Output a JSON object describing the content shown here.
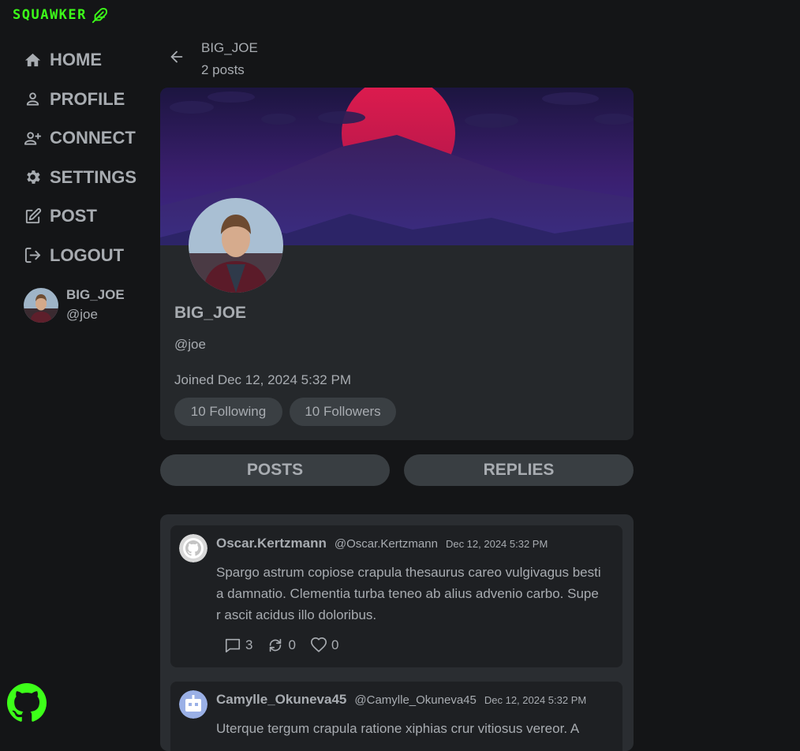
{
  "app": {
    "brand": "SQUAWKER",
    "accent_color": "#3dff19",
    "brand_icon": "feather-icon"
  },
  "sidebar": {
    "items": [
      {
        "label": "HOME",
        "icon": "home-icon"
      },
      {
        "label": "PROFILE",
        "icon": "person-icon"
      },
      {
        "label": "CONNECT",
        "icon": "person-add-icon"
      },
      {
        "label": "SETTINGS",
        "icon": "gear-icon"
      },
      {
        "label": "POST",
        "icon": "edit-icon"
      },
      {
        "label": "LOGOUT",
        "icon": "logout-icon"
      }
    ],
    "user": {
      "name": "BIG_JOE",
      "handle": "@joe"
    },
    "footer_icon": "github-icon"
  },
  "header": {
    "title": "BIG_JOE",
    "post_count": "2 posts"
  },
  "profile": {
    "name": "BIG_JOE",
    "handle": "@joe",
    "joined": "Joined Dec 12, 2024 5:32 PM",
    "following": "10 Following",
    "followers": "10 Followers"
  },
  "tabs": [
    {
      "label": "POSTS"
    },
    {
      "label": "REPLIES"
    }
  ],
  "posts": [
    {
      "author": "Oscar.Kertzmann",
      "handle": "@Oscar.Kertzmann",
      "date": "Dec 12, 2024 5:32 PM",
      "body": "Spargo astrum copiose crapula thesaurus careo vulgivagus bestia damnatio. Clementia turba teneo ab alius advenio carbo. Super ascit acidus illo doloribus.",
      "comments": "3",
      "reposts": "0",
      "likes": "0"
    },
    {
      "author": "Camylle_Okuneva45",
      "handle": "@Camylle_Okuneva45",
      "date": "Dec 12, 2024 5:32 PM",
      "body": "Uterque tergum crapula ratione xiphias crur vitiosus vereor. A"
    }
  ]
}
